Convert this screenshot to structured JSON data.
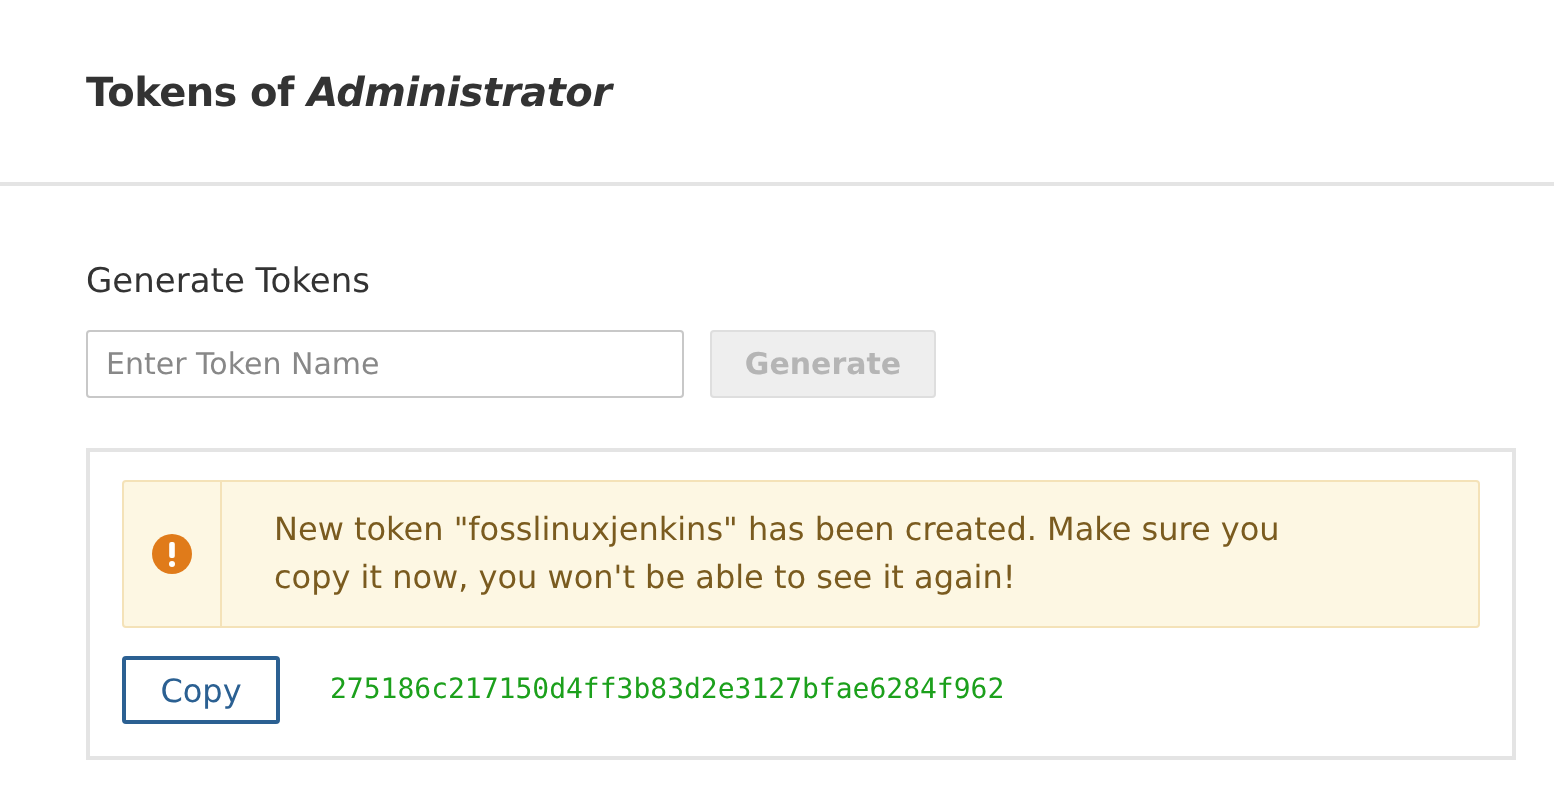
{
  "header": {
    "title": "Tokens of *Administrator*"
  },
  "generate": {
    "heading": "Generate Tokens",
    "field": {
      "placeholder": "Enter Token Name"
    },
    "button": {
      "label": "Generate",
      "disabled": true
    }
  },
  "result": {
    "alert": {
      "kind": "warning",
      "message": "New token \"fosslinuxjenkins\" has been created. Make sure you copy it now, you won't be able to see it again!"
    },
    "copy_button": "Copy",
    "token": "275186c217150d4ff3b83d2e3127bfae6284f962"
  }
}
